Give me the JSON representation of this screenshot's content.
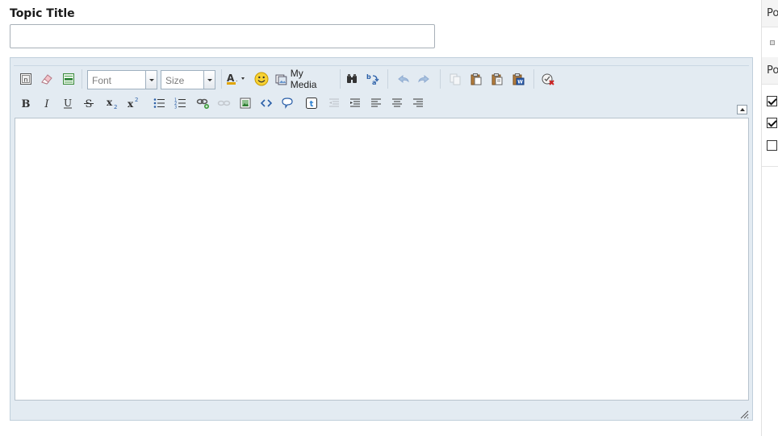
{
  "form": {
    "topic_title_label": "Topic Title",
    "topic_title_value": ""
  },
  "editor": {
    "toolbar": {
      "font_combo": "Font",
      "size_combo": "Size",
      "my_media_label": "My Media"
    },
    "body_text": ""
  },
  "side_panel": {
    "header1": "Po",
    "header2": "Po",
    "checkboxes": [
      true,
      true,
      false
    ]
  },
  "colors": {
    "editor_bg": "#e3ebf2",
    "editor_border": "#c0cfdb",
    "accent_blue": "#3b6fb6"
  }
}
